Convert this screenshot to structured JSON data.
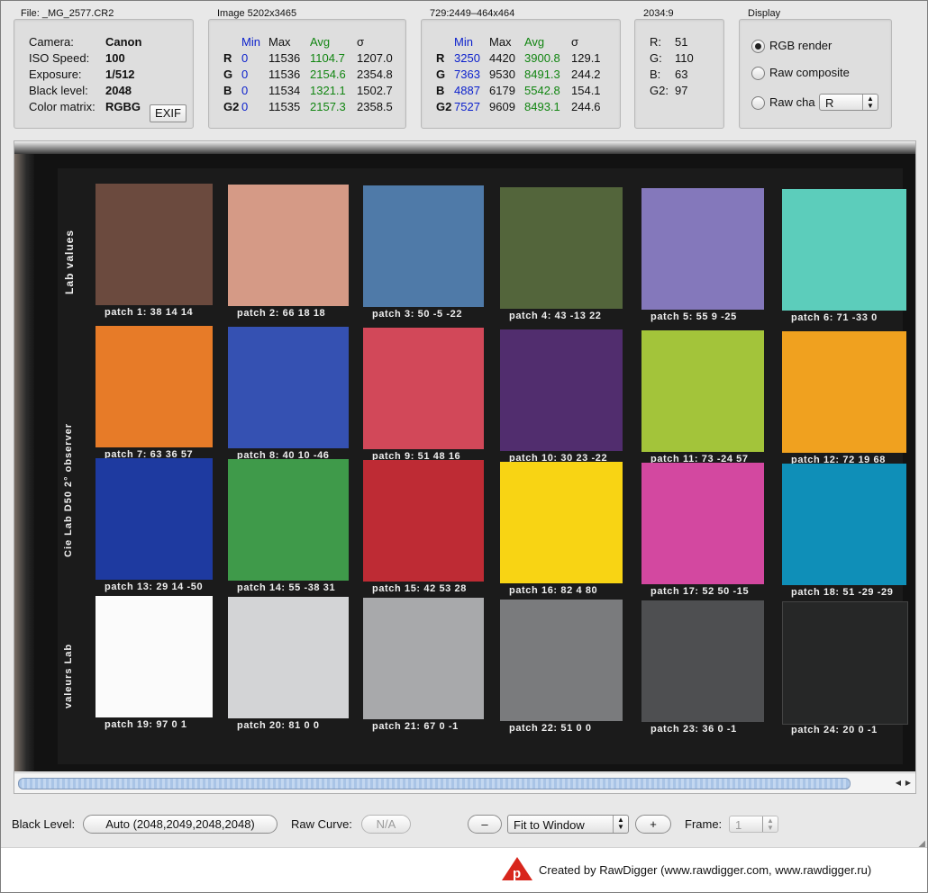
{
  "file_box": {
    "title": "File: _MG_2577.CR2",
    "rows": [
      {
        "label": "Camera:",
        "value": "Canon"
      },
      {
        "label": "ISO Speed:",
        "value": "100"
      },
      {
        "label": "Exposure:",
        "value": "1/512"
      },
      {
        "label": "Black level:",
        "value": "2048"
      },
      {
        "label": "Color matrix:",
        "value": "RGBG"
      }
    ],
    "exif_button": "EXIF"
  },
  "image_stats": {
    "title": "Image 5202x3465",
    "headers": {
      "min": "Min",
      "max": "Max",
      "avg": "Avg",
      "sigma": "σ"
    },
    "rows": [
      {
        "ch": "R",
        "min": "0",
        "max": "11536",
        "avg": "1104.7",
        "sigma": "1207.0"
      },
      {
        "ch": "G",
        "min": "0",
        "max": "11536",
        "avg": "2154.6",
        "sigma": "2354.8"
      },
      {
        "ch": "B",
        "min": "0",
        "max": "11534",
        "avg": "1321.1",
        "sigma": "1502.7"
      },
      {
        "ch": "G2",
        "min": "0",
        "max": "11535",
        "avg": "2157.3",
        "sigma": "2358.5"
      }
    ]
  },
  "sel_stats": {
    "title": "729:2449–464x464",
    "headers": {
      "min": "Min",
      "max": "Max",
      "avg": "Avg",
      "sigma": "σ"
    },
    "rows": [
      {
        "ch": "R",
        "min": "3250",
        "max": "4420",
        "avg": "3900.8",
        "sigma": "129.1"
      },
      {
        "ch": "G",
        "min": "7363",
        "max": "9530",
        "avg": "8491.3",
        "sigma": "244.2"
      },
      {
        "ch": "B",
        "min": "4887",
        "max": "6179",
        "avg": "5542.8",
        "sigma": "154.1"
      },
      {
        "ch": "G2",
        "min": "7527",
        "max": "9609",
        "avg": "8493.1",
        "sigma": "244.6"
      }
    ]
  },
  "pixel_box": {
    "title": "2034:9",
    "rows": [
      {
        "label": "R:",
        "value": "51"
      },
      {
        "label": "G:",
        "value": "110"
      },
      {
        "label": "B:",
        "value": "63"
      },
      {
        "label": "G2:",
        "value": "97"
      }
    ]
  },
  "display_box": {
    "title": "Display",
    "options": [
      "RGB render",
      "Raw composite",
      "Raw cha"
    ],
    "selected": "RGB render",
    "channel_select": "R"
  },
  "chart": {
    "side_top": "Lab values",
    "side_middle": "Cie Lab D50 2° observer",
    "side_bottom": "valeurs Lab",
    "patches": [
      {
        "label": "patch 1: 38 14 14",
        "color": "#6b4a3e"
      },
      {
        "label": "patch 2: 66 18 18",
        "color": "#d59a86"
      },
      {
        "label": "patch 3: 50 -5 -22",
        "color": "#4f7aa8"
      },
      {
        "label": "patch 4: 43 -13 22",
        "color": "#53653b"
      },
      {
        "label": "patch 5: 55 9 -25",
        "color": "#8478bb"
      },
      {
        "label": "patch 6: 71 -33 0",
        "color": "#5ccdbb"
      },
      {
        "label": "patch 7: 63 36 57",
        "color": "#e77b28"
      },
      {
        "label": "patch 8: 40 10 -46",
        "color": "#3551b2"
      },
      {
        "label": "patch 9: 51 48 16",
        "color": "#d24859"
      },
      {
        "label": "patch 10: 30 23 -22",
        "color": "#512d6e"
      },
      {
        "label": "patch 11: 73 -24 57",
        "color": "#a3c43a"
      },
      {
        "label": "patch 12: 72 19 68",
        "color": "#f0a11f"
      },
      {
        "label": "patch 13: 29 14 -50",
        "color": "#1e3aa0"
      },
      {
        "label": "patch 14: 55 -38 31",
        "color": "#3f9a4a"
      },
      {
        "label": "patch 15: 42 53 28",
        "color": "#be2b34"
      },
      {
        "label": "patch 16: 82 4 80",
        "color": "#f8d414"
      },
      {
        "label": "patch 17: 52 50 -15",
        "color": "#d348a0"
      },
      {
        "label": "patch 18: 51 -29 -29",
        "color": "#0f8fb8"
      },
      {
        "label": "patch 19: 97 0 1",
        "color": "#fbfbfb"
      },
      {
        "label": "patch 20: 81 0 0",
        "color": "#d3d4d6"
      },
      {
        "label": "patch 21: 67 0 -1",
        "color": "#a8a9ab"
      },
      {
        "label": "patch 22: 51 0 0",
        "color": "#7a7b7d"
      },
      {
        "label": "patch 23: 36 0 -1",
        "color": "#4e4f51"
      },
      {
        "label": "patch 24: 20 0 -1",
        "color": "#262727"
      }
    ]
  },
  "bottom_bar": {
    "black_level_label": "Black Level:",
    "black_level_value": "Auto (2048,2049,2048,2048)",
    "raw_curve_label": "Raw Curve:",
    "raw_curve_value": "N/A",
    "zoom_out": "–",
    "zoom_select": "Fit to Window",
    "zoom_in": "+",
    "frame_label": "Frame:",
    "frame_value": "1"
  },
  "footer": {
    "logo_color": "#d8261c",
    "text": "Created by RawDigger (www.rawdigger.com, www.rawdigger.ru)"
  }
}
